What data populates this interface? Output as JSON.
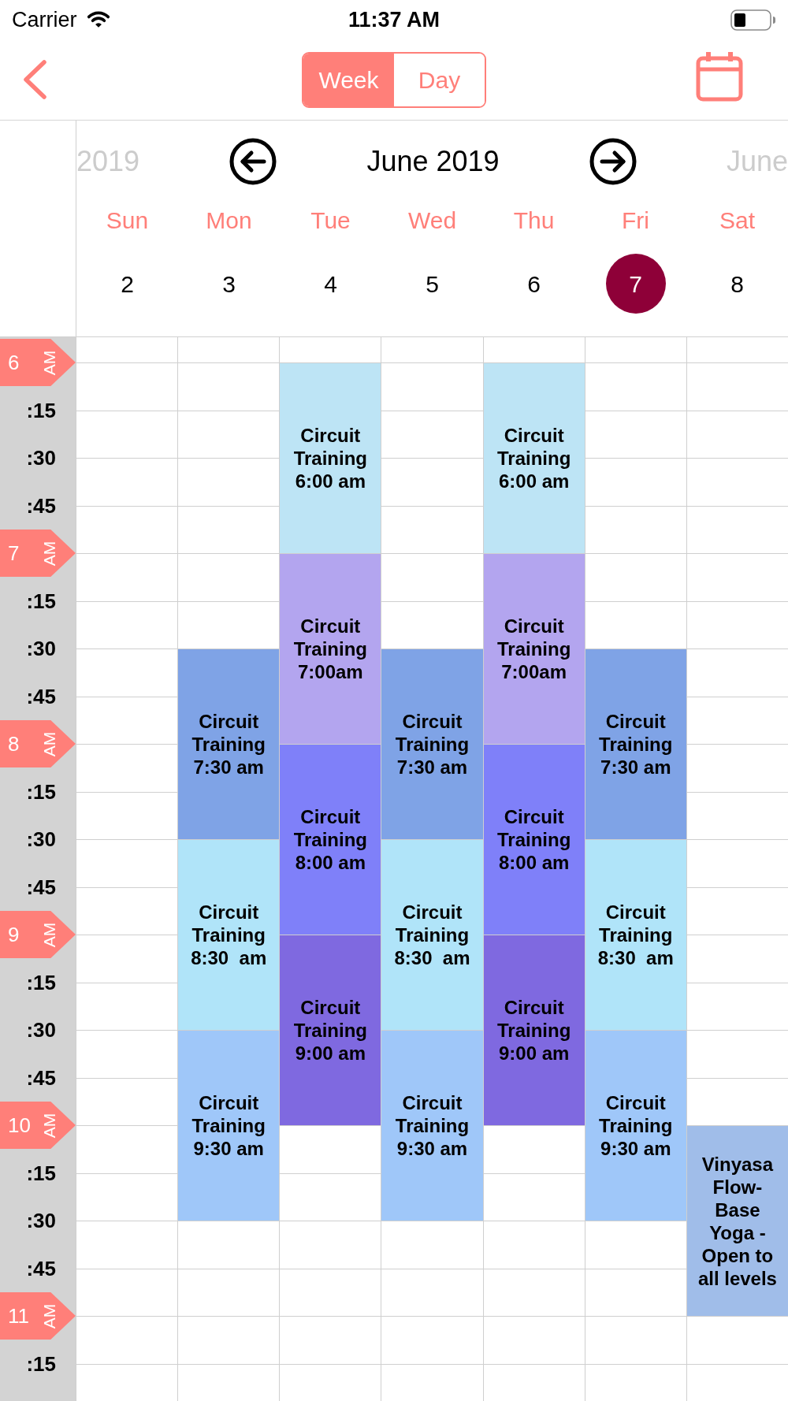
{
  "status_bar": {
    "carrier": "Carrier",
    "time": "11:37 AM"
  },
  "nav_bar": {
    "view_segments": [
      {
        "label": "Week",
        "selected": true
      },
      {
        "label": "Day",
        "selected": false
      }
    ]
  },
  "month_strip": {
    "previous_label": "2019",
    "current_label": "June 2019",
    "next_label": "June"
  },
  "days": [
    {
      "weekday": "Sun",
      "date": "2",
      "selected": false
    },
    {
      "weekday": "Mon",
      "date": "3",
      "selected": false,
      "blocks": [
        {
          "kind": "free"
        },
        {
          "kind": "free"
        },
        {
          "kind": "free"
        },
        {
          "kind": "event",
          "title": "Circuit Training",
          "time": "7:30 am",
          "color": "#7fa3e6"
        },
        {
          "kind": "event",
          "title": "Circuit Training",
          "time": "8:30  am",
          "color": "#b0e4f9"
        },
        {
          "kind": "event",
          "title": "Circuit Training",
          "time": "9:30 am",
          "color": "#9fc7f9"
        }
      ]
    },
    {
      "weekday": "Tue",
      "date": "4",
      "selected": false,
      "blocks": [
        {
          "kind": "event",
          "title": "Circuit Training",
          "time": "6:00 am",
          "color": "#bde4f5"
        },
        {
          "kind": "event",
          "title": "Circuit Training",
          "time": "7:00am",
          "color": "#b3a5ef"
        },
        {
          "kind": "event",
          "title": "Circuit Training",
          "time": "8:00 am",
          "color": "#7f80f9"
        },
        {
          "kind": "event",
          "title": "Circuit Training",
          "time": "9:00 am",
          "color": "#7f69e0"
        }
      ]
    },
    {
      "weekday": "Wed",
      "date": "5",
      "selected": false,
      "blocks": [
        {
          "kind": "free"
        },
        {
          "kind": "free"
        },
        {
          "kind": "free"
        },
        {
          "kind": "event",
          "title": "Circuit Training",
          "time": "7:30 am",
          "color": "#7fa3e6"
        },
        {
          "kind": "event",
          "title": "Circuit Training",
          "time": "8:30  am",
          "color": "#b0e4f9"
        },
        {
          "kind": "event",
          "title": "Circuit Training",
          "time": "9:30 am",
          "color": "#9fc7f9"
        }
      ]
    },
    {
      "weekday": "Thu",
      "date": "6",
      "selected": false,
      "blocks": [
        {
          "kind": "event",
          "title": "Circuit Training",
          "time": "6:00 am",
          "color": "#bde4f5"
        },
        {
          "kind": "event",
          "title": "Circuit Training",
          "time": "7:00am",
          "color": "#b3a5ef"
        },
        {
          "kind": "event",
          "title": "Circuit Training",
          "time": "8:00 am",
          "color": "#7f80f9"
        },
        {
          "kind": "event",
          "title": "Circuit Training",
          "time": "9:00 am",
          "color": "#7f69e0"
        }
      ]
    },
    {
      "weekday": "Fri",
      "date": "7",
      "selected": true,
      "blocks": [
        {
          "kind": "free"
        },
        {
          "kind": "free"
        },
        {
          "kind": "free"
        },
        {
          "kind": "event",
          "title": "Circuit Training",
          "time": "7:30 am",
          "color": "#7fa3e6"
        },
        {
          "kind": "event",
          "title": "Circuit Training",
          "time": "8:30  am",
          "color": "#b0e4f9"
        },
        {
          "kind": "event",
          "title": "Circuit Training",
          "time": "9:30 am",
          "color": "#9fc7f9"
        }
      ]
    },
    {
      "weekday": "Sat",
      "date": "8",
      "selected": false,
      "blocks": [
        {
          "kind": "free"
        },
        {
          "kind": "free"
        },
        {
          "kind": "free"
        },
        {
          "kind": "free"
        },
        {
          "kind": "free"
        },
        {
          "kind": "free"
        },
        {
          "kind": "free"
        },
        {
          "kind": "free"
        },
        {
          "kind": "event",
          "title": "Vinyasa Flow-Base Yoga - Open to all levels",
          "color": "#a0bde9"
        }
      ]
    }
  ],
  "time_rail": [
    {
      "kind": "hour",
      "label": "6",
      "period": "AM"
    },
    {
      "kind": "quarter",
      "label": ":15"
    },
    {
      "kind": "quarter",
      "label": ":30"
    },
    {
      "kind": "quarter",
      "label": ":45"
    },
    {
      "kind": "hour",
      "label": "7",
      "period": "AM"
    },
    {
      "kind": "quarter",
      "label": ":15"
    },
    {
      "kind": "quarter",
      "label": ":30"
    },
    {
      "kind": "quarter",
      "label": ":45"
    },
    {
      "kind": "hour",
      "label": "8",
      "period": "AM"
    },
    {
      "kind": "quarter",
      "label": ":15"
    },
    {
      "kind": "quarter",
      "label": ":30"
    },
    {
      "kind": "quarter",
      "label": ":45"
    },
    {
      "kind": "hour",
      "label": "9",
      "period": "AM"
    },
    {
      "kind": "quarter",
      "label": ":15"
    },
    {
      "kind": "quarter",
      "label": ":30"
    },
    {
      "kind": "quarter",
      "label": ":45"
    },
    {
      "kind": "hour",
      "label": "10",
      "period": "AM"
    },
    {
      "kind": "quarter",
      "label": ":15"
    },
    {
      "kind": "quarter",
      "label": ":30"
    },
    {
      "kind": "quarter",
      "label": ":45"
    },
    {
      "kind": "hour",
      "label": "11",
      "period": "AM"
    },
    {
      "kind": "quarter",
      "label": ":15"
    }
  ]
}
